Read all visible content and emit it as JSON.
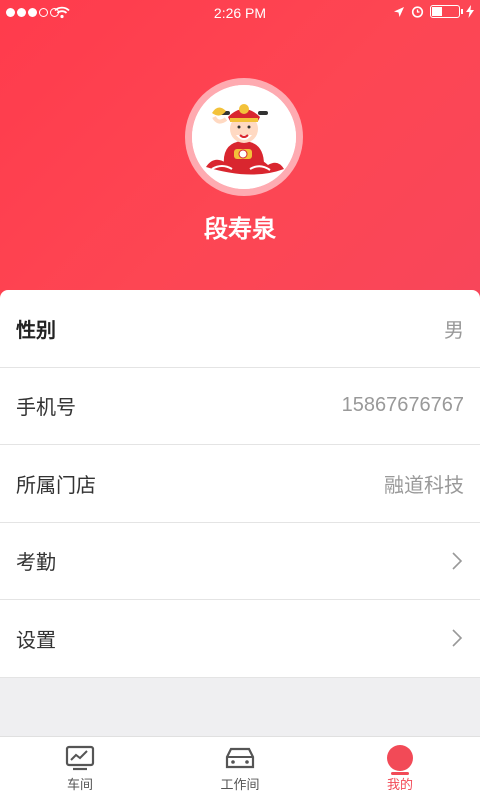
{
  "status_bar": {
    "time": "2:26 PM"
  },
  "profile": {
    "name": "段寿泉"
  },
  "info_rows": [
    {
      "label": "性别",
      "value": "男"
    },
    {
      "label": "手机号",
      "value": "15867676767"
    },
    {
      "label": "所属门店",
      "value": "融道科技"
    },
    {
      "label": "考勤",
      "value": ""
    },
    {
      "label": "设置",
      "value": ""
    }
  ],
  "tab_bar": {
    "tabs": [
      {
        "label": "车间",
        "icon": "monitor-chart-icon"
      },
      {
        "label": "工作间",
        "icon": "car-icon"
      },
      {
        "label": "我的",
        "icon": "profile-dot-icon",
        "active": true
      }
    ]
  },
  "colors": {
    "brand": "#ff3b4c",
    "active_tab": "#f24a57"
  }
}
